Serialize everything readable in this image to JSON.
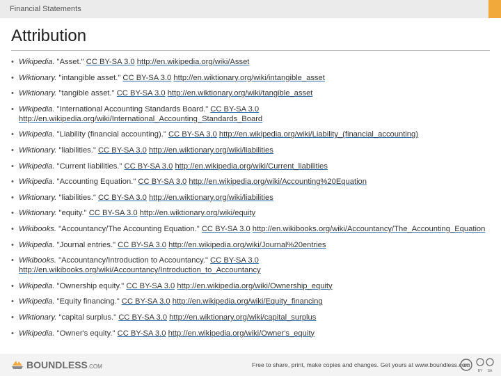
{
  "header": {
    "section_title": "Financial Statements",
    "accent_color": "#f2a93b"
  },
  "page_title": "Attribution",
  "references": [
    {
      "source": "Wikipedia.",
      "title": "\"Asset.\"",
      "license": "CC BY-SA 3.0",
      "url": "http://en.wikipedia.org/wiki/Asset"
    },
    {
      "source": "Wiktionary.",
      "title": "\"intangible asset.\"",
      "license": "CC BY-SA 3.0",
      "url": "http://en.wiktionary.org/wiki/intangible_asset"
    },
    {
      "source": "Wiktionary.",
      "title": "\"tangible asset.\"",
      "license": "CC BY-SA 3.0",
      "url": "http://en.wiktionary.org/wiki/tangible_asset"
    },
    {
      "source": "Wikipedia.",
      "title": "\"International Accounting Standards Board.\"",
      "license": "CC BY-SA 3.0",
      "url": "http://en.wikipedia.org/wiki/International_Accounting_Standards_Board"
    },
    {
      "source": "Wikipedia.",
      "title": "\"Liability (financial accounting).\"",
      "license": "CC BY-SA 3.0",
      "url": "http://en.wikipedia.org/wiki/Liability_(financial_accounting)"
    },
    {
      "source": "Wiktionary.",
      "title": "\"liabilities.\"",
      "license": "CC BY-SA 3.0",
      "url": "http://en.wiktionary.org/wiki/liabilities"
    },
    {
      "source": "Wikipedia.",
      "title": "\"Current liabilities.\"",
      "license": "CC BY-SA 3.0",
      "url": "http://en.wikipedia.org/wiki/Current_liabilities"
    },
    {
      "source": "Wikipedia.",
      "title": "\"Accounting Equation.\"",
      "license": "CC BY-SA 3.0",
      "url": "http://en.wikipedia.org/wiki/Accounting%20Equation"
    },
    {
      "source": "Wiktionary.",
      "title": "\"liabilities.\"",
      "license": "CC BY-SA 3.0",
      "url": "http://en.wiktionary.org/wiki/liabilities"
    },
    {
      "source": "Wiktionary.",
      "title": "\"equity.\"",
      "license": "CC BY-SA 3.0",
      "url": "http://en.wiktionary.org/wiki/equity"
    },
    {
      "source": "Wikibooks.",
      "title": "\"Accountancy/The Accounting Equation.\"",
      "license": "CC BY-SA 3.0",
      "url": "http://en.wikibooks.org/wiki/Accountancy/The_Accounting_Equation"
    },
    {
      "source": "Wikipedia.",
      "title": "\"Journal entries.\"",
      "license": "CC BY-SA 3.0",
      "url": "http://en.wikipedia.org/wiki/Journal%20entries"
    },
    {
      "source": "Wikibooks.",
      "title": "\"Accountancy/Introduction to Accountancy.\"",
      "license": "CC BY-SA 3.0",
      "url": "http://en.wikibooks.org/wiki/Accountancy/Introduction_to_Accountancy"
    },
    {
      "source": "Wikipedia.",
      "title": "\"Ownership equity.\"",
      "license": "CC BY-SA 3.0",
      "url": "http://en.wikipedia.org/wiki/Ownership_equity"
    },
    {
      "source": "Wikipedia.",
      "title": "\"Equity financing.\"",
      "license": "CC BY-SA 3.0",
      "url": "http://en.wikipedia.org/wiki/Equity_financing"
    },
    {
      "source": "Wiktionary.",
      "title": "\"capital surplus.\"",
      "license": "CC BY-SA 3.0",
      "url": "http://en.wiktionary.org/wiki/capital_surplus"
    },
    {
      "source": "Wikipedia.",
      "title": "\"Owner's equity.\"",
      "license": "CC BY-SA 3.0",
      "url": "http://en.wikipedia.org/wiki/Owner's_equity"
    }
  ],
  "footer": {
    "logo_text": "BOUNDLESS",
    "logo_domain": ".COM",
    "note": "Free to share, print, make copies and changes. Get yours at www.boundless.com",
    "license_icon": "cc-by-sa-icon",
    "license_labels": {
      "cc": "cc",
      "by": "BY",
      "sa": "SA"
    }
  }
}
